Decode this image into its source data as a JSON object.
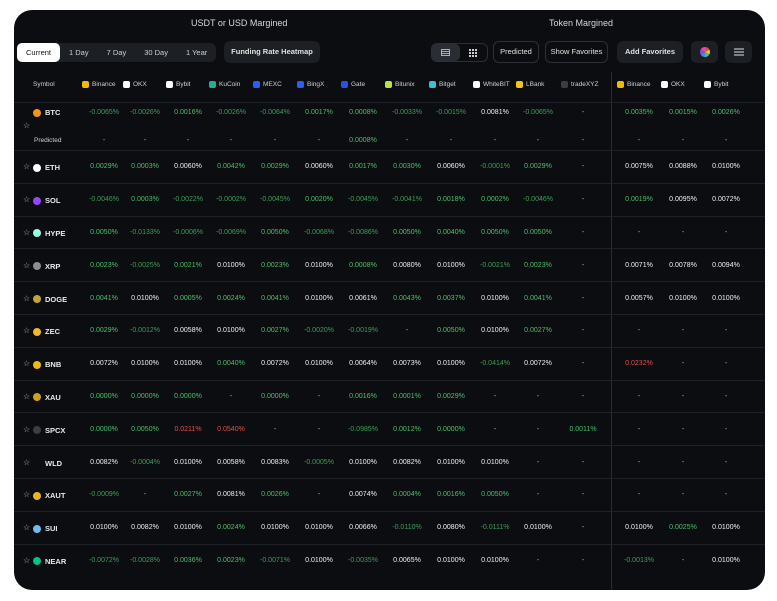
{
  "sections": {
    "usdt": "USDT or USD Margined",
    "token": "Token Margined"
  },
  "periods": [
    "Current",
    "1 Day",
    "7 Day",
    "30 Day",
    "1 Year"
  ],
  "active_period": "Current",
  "buttons": {
    "heatmap": "Funding Rate Heatmap",
    "predicted": "Predicted",
    "show_fav": "Show Favorites",
    "add_fav": "Add Favorites"
  },
  "columns": {
    "symbol": "Symbol",
    "usdt": [
      {
        "name": "Binance",
        "color": "#f0b90b"
      },
      {
        "name": "OKX",
        "color": "#ffffff"
      },
      {
        "name": "Bybit",
        "color": "#ffffff"
      },
      {
        "name": "KuCoin",
        "color": "#23af91"
      },
      {
        "name": "MEXC",
        "color": "#2a5ff6"
      },
      {
        "name": "BingX",
        "color": "#2a5ff6"
      },
      {
        "name": "Gate",
        "color": "#2354e6"
      },
      {
        "name": "Bitunix",
        "color": "#b6e34a"
      },
      {
        "name": "Bitget",
        "color": "#36c3d5"
      },
      {
        "name": "WhiteBIT",
        "color": "#ffffff"
      },
      {
        "name": "LBank",
        "color": "#f5c518"
      },
      {
        "name": "tradeXYZ",
        "color": "#3a3d44"
      }
    ],
    "token": [
      {
        "name": "Binance",
        "color": "#f0b90b"
      },
      {
        "name": "OKX",
        "color": "#ffffff"
      },
      {
        "name": "Bybit",
        "color": "#ffffff"
      }
    ]
  },
  "predicted_label": "Predicted",
  "rows": [
    {
      "symbol": "BTC",
      "icon_color": "#f7931a",
      "usdt": [
        "-0.0065%",
        "-0.0026%",
        "0.0016%",
        "-0.0026%",
        "-0.0064%",
        "0.0017%",
        "0.0008%",
        "-0.0033%",
        "-0.0015%",
        "0.0081%",
        "-0.0065%",
        "-"
      ],
      "token": [
        "0.0035%",
        "0.0015%",
        "0.0026%"
      ],
      "predicted": [
        "-",
        "-",
        "-",
        "-",
        "-",
        "-",
        "0.0008%",
        "-",
        "-",
        "-",
        "-",
        "-",
        "-",
        "-",
        "-"
      ]
    },
    {
      "symbol": "ETH",
      "icon_color": "#ffffff",
      "usdt": [
        "0.0029%",
        "0.0003%",
        "0.0060%",
        "0.0042%",
        "0.0029%",
        "0.0060%",
        "0.0017%",
        "0.0030%",
        "0.0060%",
        "-0.0001%",
        "0.0029%",
        "-"
      ],
      "token": [
        "0.0075%",
        "0.0088%",
        "0.0100%"
      ]
    },
    {
      "symbol": "SOL",
      "icon_color": "#9945ff",
      "usdt": [
        "-0.0046%",
        "0.0003%",
        "-0.0022%",
        "-0.0002%",
        "-0.0045%",
        "0.0020%",
        "-0.0045%",
        "-0.0041%",
        "0.0018%",
        "0.0002%",
        "-0.0046%",
        "-"
      ],
      "token": [
        "0.0019%",
        "0.0095%",
        "0.0072%"
      ]
    },
    {
      "symbol": "HYPE",
      "icon_color": "#97fce4",
      "usdt": [
        "0.0050%",
        "-0.0133%",
        "-0.0006%",
        "-0.0069%",
        "0.0050%",
        "-0.0068%",
        "-0.0086%",
        "0.0050%",
        "0.0040%",
        "0.0050%",
        "0.0050%",
        "-"
      ],
      "token": [
        "-",
        "-",
        "-"
      ]
    },
    {
      "symbol": "XRP",
      "icon_color": "#8a8d92",
      "usdt": [
        "0.0023%",
        "-0.0025%",
        "0.0021%",
        "0.0100%",
        "0.0023%",
        "0.0100%",
        "0.0008%",
        "0.0080%",
        "0.0100%",
        "-0.0021%",
        "0.0023%",
        "-"
      ],
      "token": [
        "0.0071%",
        "0.0078%",
        "0.0094%"
      ]
    },
    {
      "symbol": "DOGE",
      "icon_color": "#c2a633",
      "usdt": [
        "0.0041%",
        "0.0100%",
        "0.0005%",
        "0.0024%",
        "0.0041%",
        "0.0100%",
        "0.0061%",
        "0.0043%",
        "0.0037%",
        "0.0100%",
        "0.0041%",
        "-"
      ],
      "token": [
        "0.0057%",
        "0.0100%",
        "0.0100%"
      ]
    },
    {
      "symbol": "ZEC",
      "icon_color": "#f4b728",
      "usdt": [
        "0.0029%",
        "-0.0012%",
        "0.0058%",
        "0.0100%",
        "0.0027%",
        "-0.0020%",
        "-0.0019%",
        "-",
        "0.0050%",
        "0.0100%",
        "0.0027%",
        "-"
      ],
      "token": [
        "-",
        "-",
        "-"
      ]
    },
    {
      "symbol": "BNB",
      "icon_color": "#f0b90b",
      "usdt": [
        "0.0072%",
        "0.0100%",
        "0.0100%",
        "0.0040%",
        "0.0072%",
        "0.0100%",
        "0.0064%",
        "0.0073%",
        "0.0100%",
        "-0.0414%",
        "0.0072%",
        "-"
      ],
      "token": [
        "0.0232%",
        "-",
        "-"
      ]
    },
    {
      "symbol": "XAU",
      "icon_color": "#d4a017",
      "usdt": [
        "0.0000%",
        "0.0000%",
        "0.0000%",
        "-",
        "0.0000%",
        "-",
        "0.0016%",
        "0.0001%",
        "0.0029%",
        "-",
        "-",
        "-"
      ],
      "token": [
        "-",
        "-",
        "-"
      ]
    },
    {
      "symbol": "SPCX",
      "icon_color": "#3a3d44",
      "usdt": [
        "0.0000%",
        "0.0050%",
        "0.0211%",
        "0.0540%",
        "-",
        "-",
        "-0.0985%",
        "0.0012%",
        "0.0000%",
        "-",
        "-",
        "0.0011%"
      ],
      "token": [
        "-",
        "-",
        "-"
      ]
    },
    {
      "symbol": "WLD",
      "icon_color": "#0b0d10",
      "usdt": [
        "0.0082%",
        "-0.0004%",
        "0.0100%",
        "0.0058%",
        "0.0083%",
        "-0.0005%",
        "0.0100%",
        "0.0082%",
        "0.0100%",
        "0.0100%",
        "-",
        "-"
      ],
      "token": [
        "-",
        "-",
        "-"
      ]
    },
    {
      "symbol": "XAUT",
      "icon_color": "#e6b422",
      "usdt": [
        "-0.0009%",
        "-",
        "0.0027%",
        "0.0081%",
        "0.0026%",
        "-",
        "0.0074%",
        "0.0004%",
        "0.0016%",
        "0.0050%",
        "-",
        "-"
      ],
      "token": [
        "-",
        "-",
        "-"
      ]
    },
    {
      "symbol": "SUI",
      "icon_color": "#6fbcf0",
      "usdt": [
        "0.0100%",
        "0.0082%",
        "0.0100%",
        "0.0024%",
        "0.0100%",
        "0.0100%",
        "0.0066%",
        "-0.0110%",
        "0.0080%",
        "-0.0111%",
        "0.0100%",
        "-"
      ],
      "token": [
        "0.0100%",
        "0.0025%",
        "0.0100%"
      ]
    },
    {
      "symbol": "NEAR",
      "icon_color": "#00c08b",
      "usdt": [
        "-0.0072%",
        "-0.0028%",
        "0.0036%",
        "0.0023%",
        "-0.0071%",
        "0.0100%",
        "-0.0035%",
        "0.0065%",
        "0.0100%",
        "0.0100%",
        "-",
        "-"
      ],
      "token": [
        "-0.0013%",
        "-",
        "0.0100%"
      ]
    }
  ],
  "cell_colors": {
    "red_cells": [
      "BNB:token:0",
      "SPCX:usdt:2",
      "SPCX:usdt:3"
    ],
    "white_cells": [
      "0.0100%",
      "0.0060%",
      "0.0081%",
      "0.0080%",
      "0.0072%",
      "0.0064%",
      "0.0073%",
      "0.0058%",
      "0.0066%",
      "0.0088%",
      "0.0095%",
      "0.0094%",
      "0.0078%",
      "0.0071%",
      "0.0057%",
      "0.0075%",
      "0.0061%",
      "0.0082%",
      "0.0083%",
      "0.0074%",
      "0.0065%"
    ]
  }
}
